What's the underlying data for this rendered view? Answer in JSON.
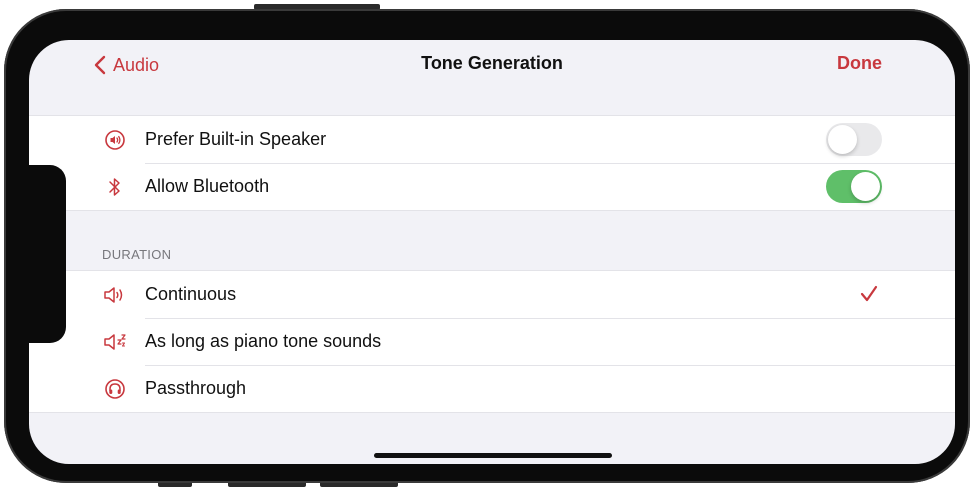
{
  "navbar": {
    "back_label": "Audio",
    "title": "Tone Generation",
    "done_label": "Done"
  },
  "output_group": {
    "items": [
      {
        "label": "Prefer Built-in Speaker",
        "icon": "speaker-circle-icon",
        "toggle_on": false
      },
      {
        "label": "Allow Bluetooth",
        "icon": "bluetooth-icon",
        "toggle_on": true
      }
    ]
  },
  "duration": {
    "header": "DURATION",
    "items": [
      {
        "label": "Continuous",
        "icon": "speaker-wave-icon",
        "selected": true
      },
      {
        "label": "As long as piano tone sounds",
        "icon": "speaker-fade-icon",
        "selected": false
      },
      {
        "label": "Passthrough",
        "icon": "headphones-circle-icon",
        "selected": false
      }
    ]
  },
  "colors": {
    "accent": "#c8383e",
    "toggle_on": "#5fbf69",
    "toggle_off": "#e9e9eb",
    "background": "#f2f2f7"
  }
}
